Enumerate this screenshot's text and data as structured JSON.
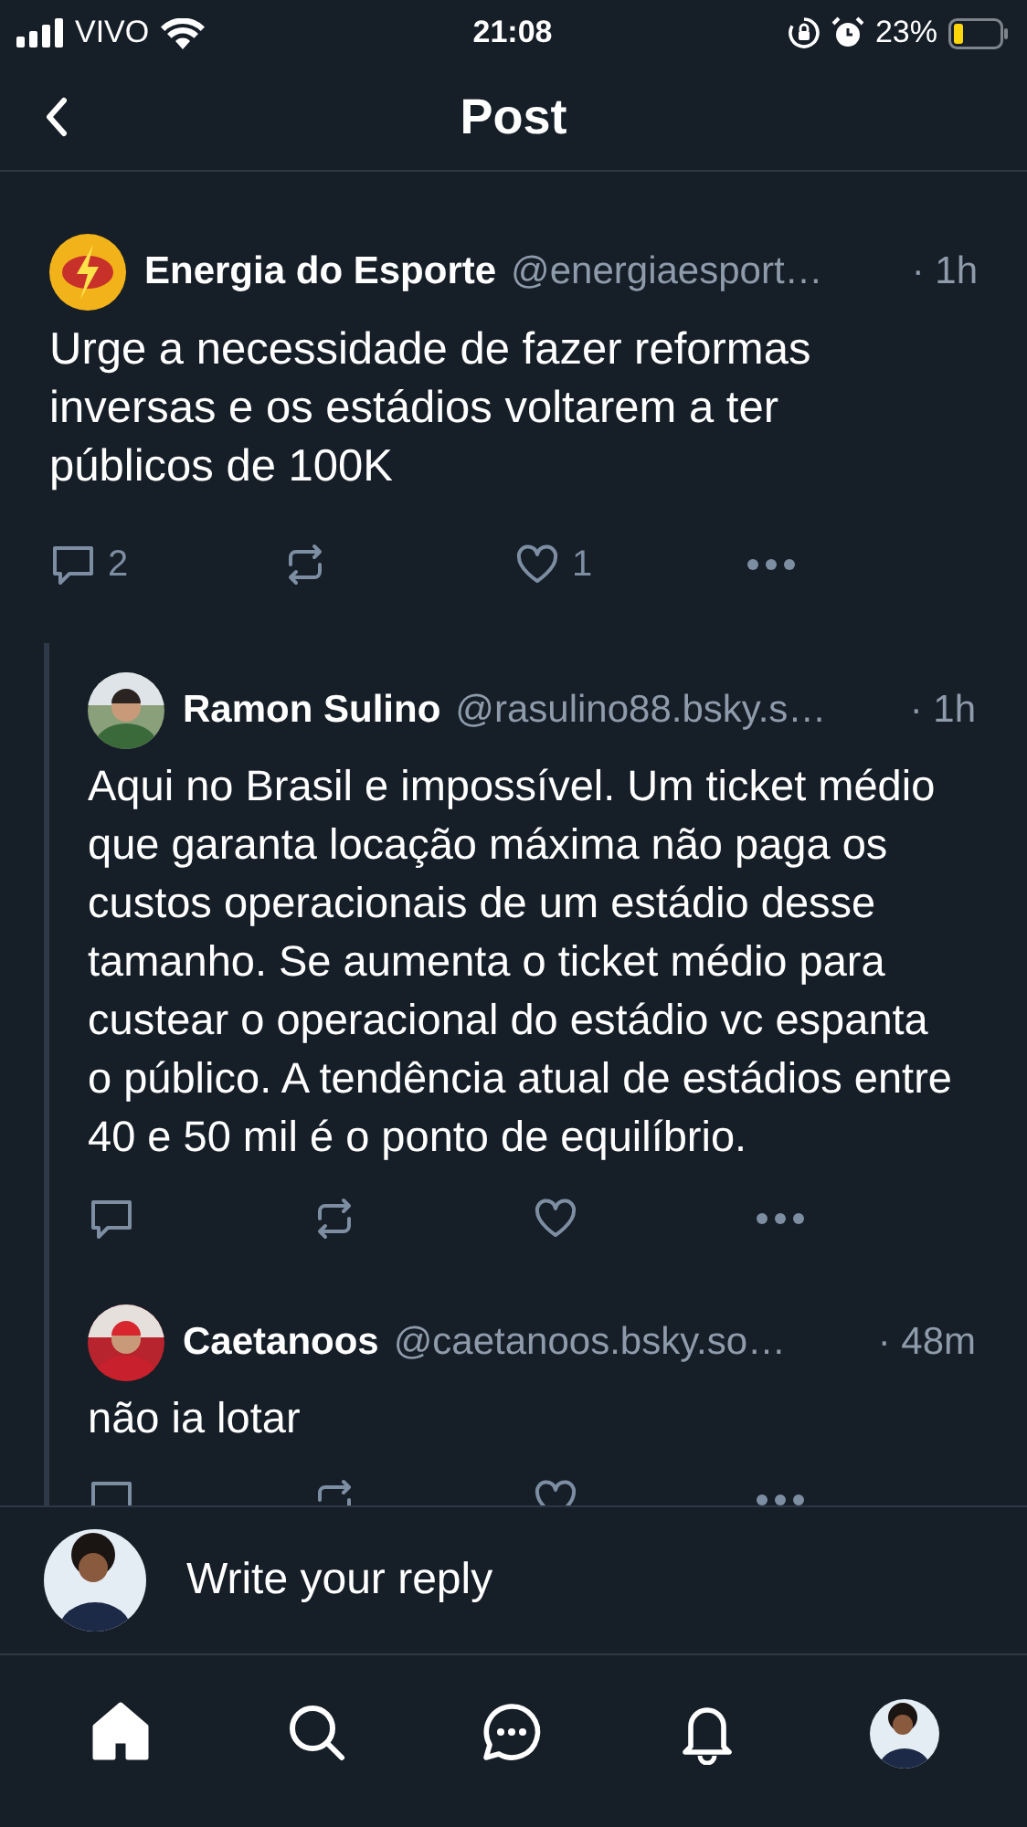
{
  "status_bar": {
    "carrier": "VIVO",
    "time": "21:08",
    "battery": "23%"
  },
  "header": {
    "title": "Post"
  },
  "posts": [
    {
      "name": "Energia do Esporte",
      "handle": "@energiaesport…",
      "time": "· 1h",
      "text": "Urge a necessidade de fazer reformas inversas e os estádios voltarem a ter públicos de 100K",
      "reply_count": "2",
      "like_count": "1"
    },
    {
      "name": "Ramon Sulino",
      "handle": "@rasulino88.bsky.s…",
      "time": "· 1h",
      "text": "Aqui no Brasil e impossível. Um ticket médio que garanta locação máxima não paga os custos operacionais de um estádio desse tamanho. Se aumenta o ticket médio para custear o operacional do estádio vc espanta o público. A tendência atual de estádios entre 40 e 50 mil é o ponto de equilíbrio."
    },
    {
      "name": "Caetanoos",
      "handle": "@caetanoos.bsky.so…",
      "time": "· 48m",
      "text": "não ia lotar"
    }
  ],
  "reply_bar": {
    "placeholder": "Write your reply"
  },
  "tab_bar": [
    {
      "kind": "home",
      "selected": true
    },
    {
      "kind": "search",
      "selected": false
    },
    {
      "kind": "chat",
      "selected": false
    },
    {
      "kind": "bell",
      "selected": false
    },
    {
      "kind": "profile",
      "selected": false
    }
  ]
}
